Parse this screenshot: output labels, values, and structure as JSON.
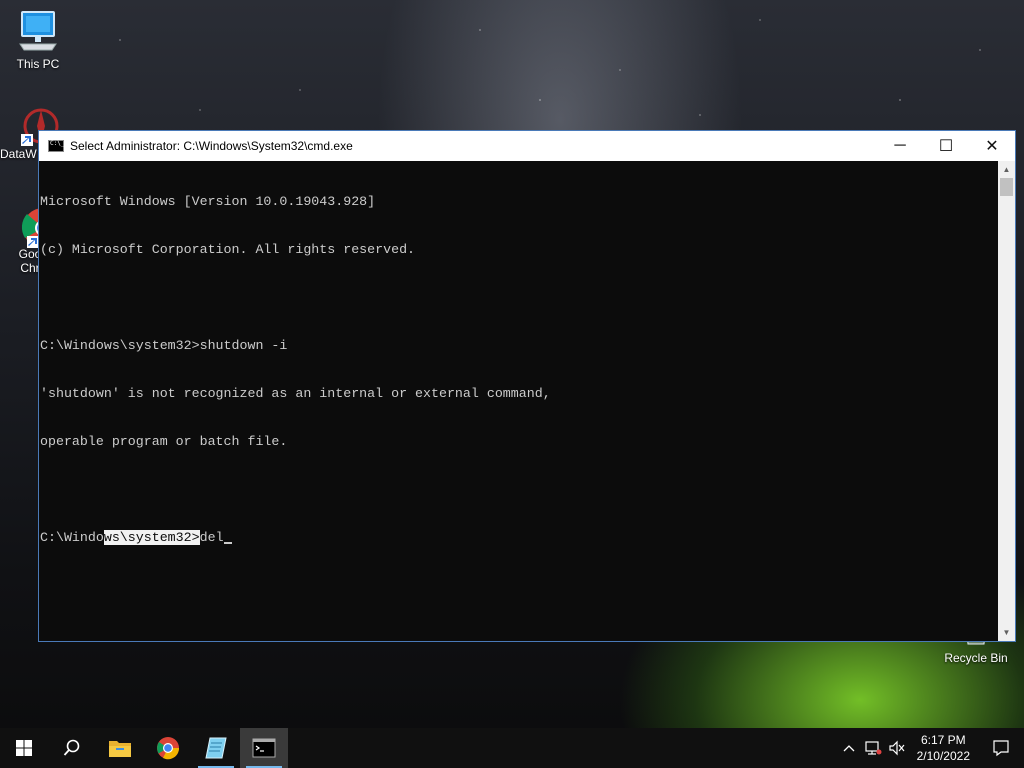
{
  "desktop": {
    "icons": [
      {
        "label": "This PC"
      },
      {
        "label": "DataW"
      },
      {
        "label": "Goo"
      },
      {
        "label": "Chr"
      },
      {
        "label": "Recycle Bin"
      }
    ]
  },
  "window": {
    "title": "Select Administrator: C:\\Windows\\System32\\cmd.exe",
    "minimize": "─",
    "maximize": "☐",
    "close": "✕"
  },
  "console": {
    "line1": "Microsoft Windows [Version 10.0.19043.928]",
    "line2": "(c) Microsoft Corporation. All rights reserved.",
    "line3": "",
    "line4": "C:\\Windows\\system32>shutdown -i",
    "line5": "'shutdown' is not recognized as an internal or external command,",
    "line6": "operable program or batch file.",
    "line7": "",
    "prompt_pre": "C:\\Windo",
    "prompt_selected": "ws\\system32>",
    "prompt_input": "del"
  },
  "taskbar": {
    "items": [
      {
        "icon": "windows-start-icon"
      },
      {
        "icon": "search-icon"
      },
      {
        "icon": "file-explorer-icon"
      },
      {
        "icon": "chrome-icon"
      },
      {
        "icon": "notepad-icon"
      },
      {
        "icon": "cmd-icon"
      }
    ],
    "clock": {
      "time": "6:17 PM",
      "date": "2/10/2022"
    }
  },
  "colors": {
    "console_bg": "#0c0c0c",
    "console_fg": "#cccccc",
    "taskbar_bg": "#101010",
    "accent": "#76b9ed"
  }
}
